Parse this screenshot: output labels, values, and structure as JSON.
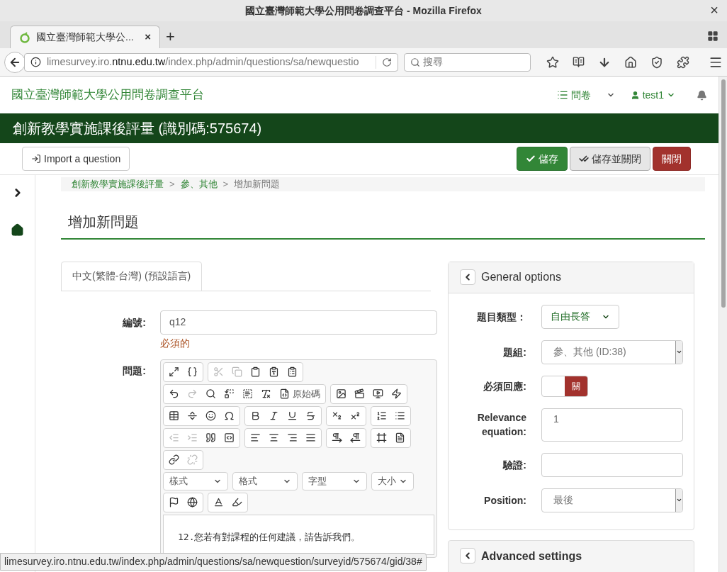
{
  "browser": {
    "window_title": "國立臺灣師範大學公用問卷調查平台 - Mozilla Firefox",
    "close": "×",
    "tab": {
      "title": "國立臺灣師範大學公...",
      "close": "×",
      "selected": true
    },
    "new_tab": "+",
    "url": {
      "prefix": "limesurvey.iro.",
      "host": "ntnu.edu.tw",
      "path": "/index.php/admin/questions/sa/newquestio"
    },
    "search": {
      "placeholder": "搜尋"
    }
  },
  "navbar": {
    "brand": "國立臺灣師範大學公用問卷調查平台",
    "menus": [
      {
        "kind": "list",
        "label": "問卷"
      },
      {
        "kind": "user",
        "label": "test1"
      }
    ]
  },
  "survey_title": "創新教學實施課後評量 (識別碼:575674)",
  "toolbar": {
    "import": "Import a question",
    "actions": [
      {
        "kind": "save",
        "label": "儲存"
      },
      {
        "kind": "save_close",
        "label": "儲存並關閉"
      },
      {
        "kind": "close",
        "label": "關閉"
      }
    ]
  },
  "breadcrumb": [
    {
      "label": "創新教學實施課後評量",
      "current": false
    },
    {
      "separator": ">",
      "label": "參、其他",
      "current": false
    },
    {
      "separator": ">",
      "label": "增加新問題",
      "current": true
    }
  ],
  "heading": "增加新問題",
  "language_tabs": [
    {
      "label": "中文(繁體-台灣) (預設語言)",
      "selected": true
    }
  ],
  "code_field": {
    "label": "編號:",
    "value": "q12",
    "note": "必須的"
  },
  "question_field": {
    "label": "問題:",
    "editor": {
      "toolbar_rows": [
        [
          [
            {
              "kind": "maximize",
              "disabled": false
            },
            {
              "kind": "placeholder",
              "disabled": false
            }
          ],
          [
            {
              "kind": "cut",
              "disabled": true
            },
            {
              "kind": "copy",
              "disabled": true
            },
            {
              "kind": "paste",
              "disabled": false
            },
            {
              "kind": "paste_text",
              "disabled": false
            },
            {
              "kind": "paste_word",
              "disabled": false
            }
          ]
        ],
        [
          [
            {
              "kind": "undo",
              "disabled": false
            },
            {
              "kind": "redo",
              "disabled": true
            },
            {
              "kind": "find",
              "disabled": false
            },
            {
              "kind": "replace",
              "disabled": false
            },
            {
              "kind": "select_all",
              "disabled": false
            },
            {
              "kind": "remove_format",
              "disabled": false
            },
            {
              "kind": "source",
              "disabled": false,
              "label": "原始碼"
            }
          ],
          [
            {
              "kind": "image",
              "disabled": false
            },
            {
              "kind": "video",
              "disabled": false
            },
            {
              "kind": "youtube",
              "disabled": false
            },
            {
              "kind": "flash",
              "disabled": false
            }
          ]
        ],
        [
          [
            {
              "kind": "table",
              "disabled": false
            },
            {
              "kind": "rule",
              "disabled": false
            },
            {
              "kind": "smiley",
              "disabled": false
            },
            {
              "kind": "omega",
              "disabled": false
            }
          ],
          [
            {
              "kind": "bold",
              "disabled": false
            },
            {
              "kind": "italic",
              "disabled": false
            },
            {
              "kind": "underline",
              "disabled": false
            },
            {
              "kind": "strike",
              "disabled": false
            }
          ],
          [
            {
              "kind": "subscript",
              "disabled": false
            },
            {
              "kind": "superscript",
              "disabled": false
            }
          ],
          [
            {
              "kind": "ordered_list",
              "disabled": false
            },
            {
              "kind": "bullet_list",
              "disabled": false
            }
          ]
        ],
        [
          [
            {
              "kind": "outdent",
              "disabled": true
            },
            {
              "kind": "indent",
              "disabled": true
            },
            {
              "kind": "quote",
              "disabled": false
            },
            {
              "kind": "div",
              "disabled": false
            }
          ],
          [
            {
              "kind": "align_left",
              "disabled": false
            },
            {
              "kind": "align_center",
              "disabled": false
            },
            {
              "kind": "align_right",
              "disabled": false
            },
            {
              "kind": "justify",
              "disabled": false
            }
          ],
          [
            {
              "kind": "ltr",
              "disabled": false
            },
            {
              "kind": "rtl",
              "disabled": false
            }
          ],
          [
            {
              "kind": "iframe",
              "disabled": false
            },
            {
              "kind": "template",
              "disabled": false
            }
          ]
        ],
        [
          [
            {
              "kind": "link",
              "disabled": false
            },
            {
              "kind": "unlink",
              "disabled": true
            }
          ]
        ]
      ],
      "dropdowns": [
        "樣式",
        "格式",
        "字型",
        "大小"
      ],
      "bottom_row": [
        [
          {
            "kind": "anchor",
            "disabled": false
          },
          {
            "kind": "globe",
            "disabled": false
          }
        ],
        [
          {
            "kind": "text_color",
            "disabled": false
          },
          {
            "kind": "bg_color",
            "disabled": false
          }
        ]
      ],
      "content": "12.您若有對課程的任何建議，請告訴我們。"
    }
  },
  "general_options": {
    "title": "General options",
    "expanded": true,
    "fields": [
      {
        "kind": "dropdown",
        "label": "題目類型：",
        "value": "自由長答"
      },
      {
        "kind": "select",
        "label": "題組:",
        "value": "參、其他 (ID:38)"
      },
      {
        "kind": "toggle",
        "label": "必須回應:",
        "on": false,
        "off_text": "關"
      },
      {
        "kind": "textarea",
        "label": "Relevance equation:",
        "value": "1"
      },
      {
        "kind": "input",
        "label": "驗證:"
      },
      {
        "kind": "select",
        "label": "Position:",
        "value": "最後"
      }
    ]
  },
  "advanced_settings": {
    "title": "Advanced settings",
    "expanded": false
  },
  "status_url": "limesurvey.iro.ntnu.edu.tw/index.php/admin/questions/sa/newquestion/surveyid/575674/gid/38#"
}
